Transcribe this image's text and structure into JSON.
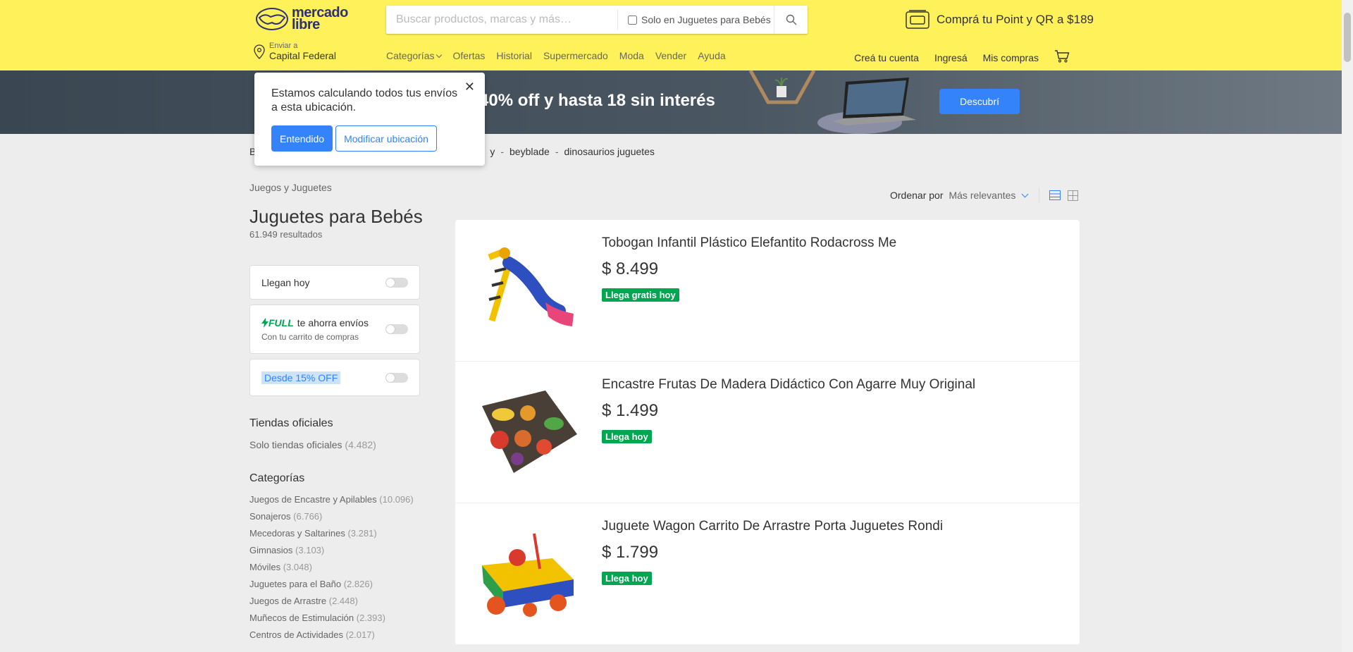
{
  "header": {
    "logo_text_line1": "mercado",
    "logo_text_line2": "libre",
    "search": {
      "placeholder": "Buscar productos, marcas y más…",
      "filter_label": "Solo en Juguetes para Bebés"
    },
    "promo": "Comprá tu Point y QR a $189",
    "ship_to_label": "Enviar a",
    "ship_to_location": "Capital Federal",
    "nav": [
      "Categorías",
      "Ofertas",
      "Historial",
      "Supermercado",
      "Moda",
      "Vender",
      "Ayuda"
    ],
    "user_nav": [
      "Creá tu cuenta",
      "Ingresá",
      "Mis compras"
    ]
  },
  "banner": {
    "text": "a 40% off y hasta 18 sin interés",
    "button": "Descubrí"
  },
  "popup": {
    "message": "Estamos calculando todos tus envíos a esta ubicación.",
    "primary": "Entendido",
    "secondary": "Modificar ubicación"
  },
  "breadcrumbs": [
    "B",
    "y",
    "beyblade",
    "dinosaurios juguetes"
  ],
  "category_link": "Juegos y Juguetes",
  "page_title": "Juguetes para Bebés",
  "results_count": "61.949 resultados",
  "filters": {
    "today": "Llegan hoy",
    "full_word": "FULL",
    "full_text": "te ahorra envíos",
    "full_sub": "Con tu carrito de compras",
    "discount": "Desde 15% OFF"
  },
  "stores": {
    "title": "Tiendas oficiales",
    "link": "Solo tiendas oficiales",
    "count": "(4.482)"
  },
  "categories": {
    "title": "Categorías",
    "items": [
      {
        "name": "Juegos de Encastre y Apilables",
        "count": "(10.096)"
      },
      {
        "name": "Sonajeros",
        "count": "(6.766)"
      },
      {
        "name": "Mecedoras y Saltarines",
        "count": "(3.281)"
      },
      {
        "name": "Gimnasios",
        "count": "(3.103)"
      },
      {
        "name": "Móviles",
        "count": "(3.048)"
      },
      {
        "name": "Juguetes para el Baño",
        "count": "(2.826)"
      },
      {
        "name": "Juegos de Arrastre",
        "count": "(2.448)"
      },
      {
        "name": "Muñecos de Estimulación",
        "count": "(2.393)"
      },
      {
        "name": "Centros de Actividades",
        "count": "(2.017)"
      }
    ]
  },
  "sort": {
    "label": "Ordenar por",
    "value": "Más relevantes"
  },
  "products": [
    {
      "title": "Tobogan Infantil Plástico Elefantito Rodacross Me",
      "price": "$ 8.499",
      "badge": "Llega gratis hoy",
      "icon": "slide-toy"
    },
    {
      "title": "Encastre Frutas De Madera Didáctico Con Agarre Muy Original",
      "price": "$ 1.499",
      "badge": "Llega hoy",
      "icon": "fruit-puzzle"
    },
    {
      "title": "Juguete Wagon Carrito De Arrastre Porta Juguetes Rondi",
      "price": "$ 1.799",
      "badge": "Llega hoy",
      "icon": "wagon-toy"
    }
  ],
  "colors": {
    "header_yellow": "#fff159",
    "brand_blue": "#3483fa",
    "badge_green": "#00a650"
  }
}
